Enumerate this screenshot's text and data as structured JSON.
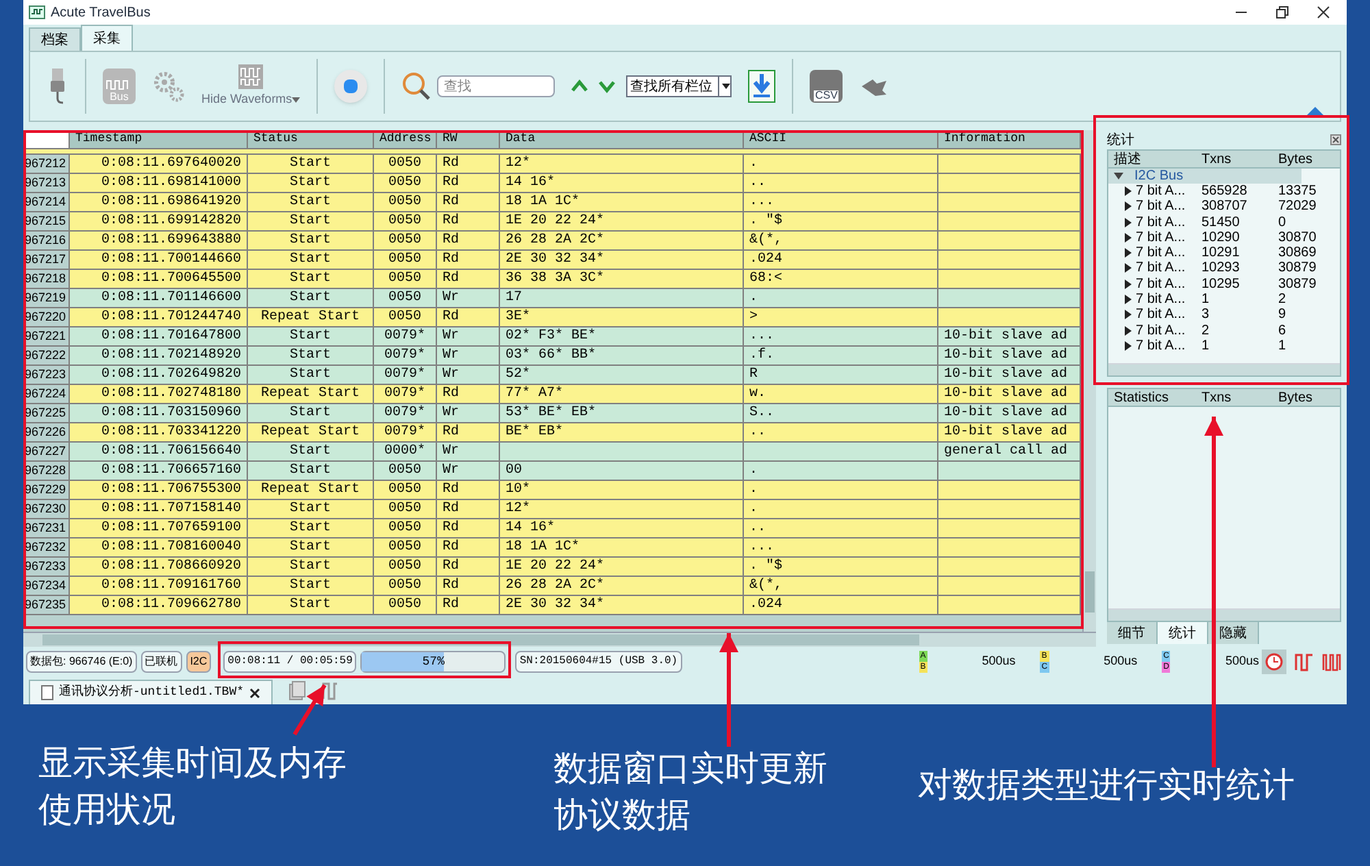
{
  "window": {
    "title": "Acute TravelBus"
  },
  "tabs": [
    {
      "label": "档案",
      "selected": false
    },
    {
      "label": "采集",
      "selected": true
    }
  ],
  "toolbar": {
    "bus_icon_label": "Bus",
    "hide_waveforms": "Hide Waveforms",
    "search": {
      "placeholder": "查找"
    },
    "search_scope": "查找所有栏位",
    "csv_icon_label": "CSV"
  },
  "table": {
    "columns": [
      "Timestamp",
      "Status",
      "Address",
      "RW",
      "Data",
      "ASCII",
      "Information"
    ],
    "rows": [
      {
        "n": "967212",
        "timestamp": "0:08:11.697640020",
        "status": "Start",
        "address": "0050",
        "rw": "Rd",
        "data": "12*",
        "ascii": ".",
        "color": "#fbf38f"
      },
      {
        "n": "967213",
        "timestamp": "0:08:11.698141000",
        "status": "Start",
        "address": "0050",
        "rw": "Rd",
        "data": "14 16*",
        "ascii": "..",
        "color": "#fbf38f"
      },
      {
        "n": "967214",
        "timestamp": "0:08:11.698641920",
        "status": "Start",
        "address": "0050",
        "rw": "Rd",
        "data": "18 1A 1C*",
        "ascii": "...",
        "color": "#fbf38f"
      },
      {
        "n": "967215",
        "timestamp": "0:08:11.699142820",
        "status": "Start",
        "address": "0050",
        "rw": "Rd",
        "data": "1E 20 22 24*",
        "ascii": ". \"$",
        "color": "#fbf38f"
      },
      {
        "n": "967216",
        "timestamp": "0:08:11.699643880",
        "status": "Start",
        "address": "0050",
        "rw": "Rd",
        "data": "26 28 2A 2C*",
        "ascii": "&(*,",
        "color": "#fbf38f"
      },
      {
        "n": "967217",
        "timestamp": "0:08:11.700144660",
        "status": "Start",
        "address": "0050",
        "rw": "Rd",
        "data": "2E 30 32 34*",
        "ascii": ".024",
        "color": "#fbf38f"
      },
      {
        "n": "967218",
        "timestamp": "0:08:11.700645500",
        "status": "Start",
        "address": "0050",
        "rw": "Rd",
        "data": "36 38 3A 3C*",
        "ascii": "68:<",
        "color": "#fbf38f"
      },
      {
        "n": "967219",
        "timestamp": "0:08:11.701146600",
        "status": "Start",
        "address": "0050",
        "rw": "Wr",
        "data": "17",
        "ascii": ".",
        "color": "#c9ead8"
      },
      {
        "n": "967220",
        "timestamp": "0:08:11.701244740",
        "status": "Repeat Start",
        "address": "0050",
        "rw": "Rd",
        "data": "3E*",
        "ascii": ">",
        "color": "#fbf38f"
      },
      {
        "n": "967221",
        "timestamp": "0:08:11.701647800",
        "status": "Start",
        "address": "0079*",
        "rw": "Wr",
        "data": "02* F3* BE*",
        "ascii": "...",
        "info": "10-bit slave ad",
        "color": "#c9ead8"
      },
      {
        "n": "967222",
        "timestamp": "0:08:11.702148920",
        "status": "Start",
        "address": "0079*",
        "rw": "Wr",
        "data": "03* 66* BB*",
        "ascii": ".f.",
        "info": "10-bit slave ad",
        "color": "#c9ead8"
      },
      {
        "n": "967223",
        "timestamp": "0:08:11.702649820",
        "status": "Start",
        "address": "0079*",
        "rw": "Wr",
        "data": "52*",
        "ascii": "R",
        "info": "10-bit slave ad",
        "color": "#c9ead8"
      },
      {
        "n": "967224",
        "timestamp": "0:08:11.702748180",
        "status": "Repeat Start",
        "address": "0079*",
        "rw": "Rd",
        "data": "77* A7*",
        "ascii": "w.",
        "info": "10-bit slave ad",
        "color": "#fbf38f"
      },
      {
        "n": "967225",
        "timestamp": "0:08:11.703150960",
        "status": "Start",
        "address": "0079*",
        "rw": "Wr",
        "data": "53* BE* EB*",
        "ascii": "S..",
        "info": "10-bit slave ad",
        "color": "#c9ead8"
      },
      {
        "n": "967226",
        "timestamp": "0:08:11.703341220",
        "status": "Repeat Start",
        "address": "0079*",
        "rw": "Rd",
        "data": "BE* EB*",
        "ascii": "..",
        "info": "10-bit slave ad",
        "color": "#fbf38f"
      },
      {
        "n": "967227",
        "timestamp": "0:08:11.706156640",
        "status": "Start",
        "address": "0000*",
        "rw": "Wr",
        "data": "",
        "ascii": "",
        "info": "general call ad",
        "color": "#c9ead8"
      },
      {
        "n": "967228",
        "timestamp": "0:08:11.706657160",
        "status": "Start",
        "address": "0050",
        "rw": "Wr",
        "data": "00",
        "ascii": ".",
        "color": "#c9ead8"
      },
      {
        "n": "967229",
        "timestamp": "0:08:11.706755300",
        "status": "Repeat Start",
        "address": "0050",
        "rw": "Rd",
        "data": "10*",
        "ascii": ".",
        "color": "#fbf38f"
      },
      {
        "n": "967230",
        "timestamp": "0:08:11.707158140",
        "status": "Start",
        "address": "0050",
        "rw": "Rd",
        "data": "12*",
        "ascii": ".",
        "color": "#fbf38f"
      },
      {
        "n": "967231",
        "timestamp": "0:08:11.707659100",
        "status": "Start",
        "address": "0050",
        "rw": "Rd",
        "data": "14 16*",
        "ascii": "..",
        "color": "#fbf38f"
      },
      {
        "n": "967232",
        "timestamp": "0:08:11.708160040",
        "status": "Start",
        "address": "0050",
        "rw": "Rd",
        "data": "18 1A 1C*",
        "ascii": "...",
        "color": "#fbf38f"
      },
      {
        "n": "967233",
        "timestamp": "0:08:11.708660920",
        "status": "Start",
        "address": "0050",
        "rw": "Rd",
        "data": "1E 20 22 24*",
        "ascii": ". \"$",
        "color": "#fbf38f"
      },
      {
        "n": "967234",
        "timestamp": "0:08:11.709161760",
        "status": "Start",
        "address": "0050",
        "rw": "Rd",
        "data": "26 28 2A 2C*",
        "ascii": "&(*,",
        "color": "#fbf38f"
      },
      {
        "n": "967235",
        "timestamp": "0:08:11.709662780",
        "status": "Start",
        "address": "0050",
        "rw": "Rd",
        "data": "2E 30 32 34*",
        "ascii": ".024",
        "color": "#fbf38f"
      }
    ]
  },
  "stats_panel": {
    "title": "统计",
    "columns": [
      "描述",
      "Txns",
      "Bytes"
    ],
    "tree": [
      {
        "label": "I2C Bus",
        "expanded": true,
        "children": [
          {
            "label": "7 bit A...",
            "txns": "565928",
            "bytes": "13375"
          },
          {
            "label": "7 bit A...",
            "txns": "308707",
            "bytes": "72029"
          },
          {
            "label": "7 bit A...",
            "txns": "51450",
            "bytes": "0"
          },
          {
            "label": "7 bit A...",
            "txns": "10290",
            "bytes": "30870"
          },
          {
            "label": "7 bit A...",
            "txns": "10291",
            "bytes": "30869"
          },
          {
            "label": "7 bit A...",
            "txns": "10293",
            "bytes": "30879"
          },
          {
            "label": "7 bit A...",
            "txns": "10295",
            "bytes": "30879"
          },
          {
            "label": "7 bit A...",
            "txns": "1",
            "bytes": "2"
          },
          {
            "label": "7 bit A...",
            "txns": "3",
            "bytes": "9"
          },
          {
            "label": "7 bit A...",
            "txns": "2",
            "bytes": "6"
          },
          {
            "label": "7 bit A...",
            "txns": "1",
            "bytes": "1"
          }
        ]
      }
    ],
    "lower_columns": [
      "Statistics",
      "Txns",
      "Bytes"
    ],
    "tabs": [
      {
        "label": "细节",
        "selected": false
      },
      {
        "label": "统计",
        "selected": true
      },
      {
        "label": "隐藏",
        "selected": false
      }
    ]
  },
  "status_bar": {
    "packets": "数据包: 966746 (E:0)",
    "connection": "已联机",
    "protocol": "I2C",
    "time": "00:08:11 / 00:05:59",
    "memory": {
      "level": 0.57,
      "reading": "57%"
    },
    "serial": "SN:20150604#15 (USB 3.0)",
    "markers": [
      {
        "top": {
          "label": "A",
          "color": "#7ed957"
        },
        "bottom": {
          "label": "B",
          "color": "#f5e35a"
        },
        "reading": "500us"
      },
      {
        "top": {
          "label": "B",
          "color": "#f5e35a"
        },
        "bottom": {
          "label": "C",
          "color": "#7ec8f0"
        },
        "reading": "500us"
      },
      {
        "top": {
          "label": "C",
          "color": "#7ec8f0"
        },
        "bottom": {
          "label": "D",
          "color": "#f07ad8"
        },
        "reading": "500us"
      }
    ]
  },
  "document_tab": {
    "label": "通讯协议分析-untitled1.TBW*"
  },
  "annotations": [
    {
      "text": "显示采集时间及内存使用状况"
    },
    {
      "text": "数据窗口实时更新协议数据"
    },
    {
      "text": "对数据类型进行实时统计"
    }
  ]
}
